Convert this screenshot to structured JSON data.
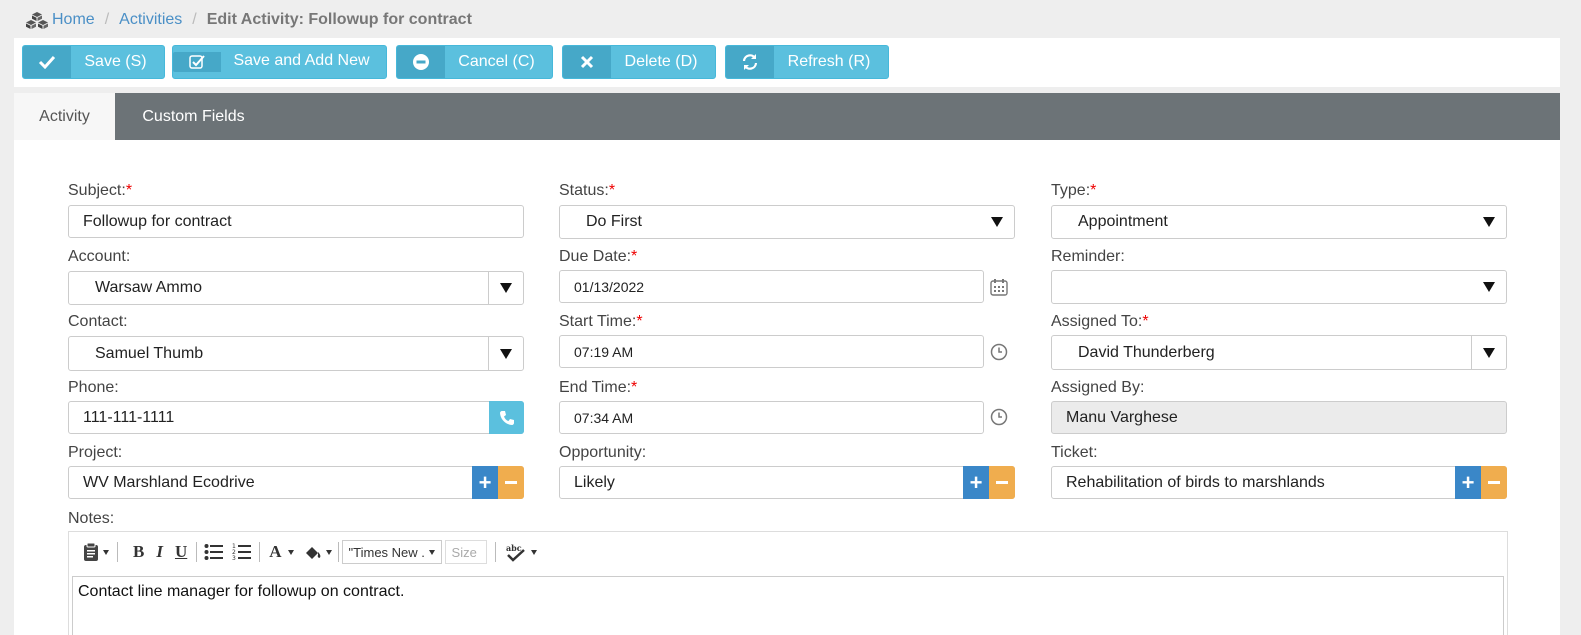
{
  "breadcrumb": {
    "home": "Home",
    "activities": "Activities",
    "current": "Edit Activity: Followup for contract"
  },
  "toolbar": {
    "save": "Save (S)",
    "save_add_new": "Save and Add New",
    "cancel": "Cancel (C)",
    "delete": "Delete (D)",
    "refresh": "Refresh (R)"
  },
  "tabs": {
    "activity": "Activity",
    "custom_fields": "Custom Fields"
  },
  "form": {
    "subject": {
      "label": "Subject:",
      "required": "*",
      "value": "Followup for contract"
    },
    "status": {
      "label": "Status:",
      "required": "*",
      "value": "Do First"
    },
    "type": {
      "label": "Type:",
      "required": "*",
      "value": "Appointment"
    },
    "account": {
      "label": "Account:",
      "value": "Warsaw Ammo"
    },
    "due_date": {
      "label": "Due Date:",
      "required": "*",
      "value": "01/13/2022"
    },
    "reminder": {
      "label": "Reminder:",
      "value": ""
    },
    "contact": {
      "label": "Contact:",
      "value": "Samuel Thumb"
    },
    "start_time": {
      "label": "Start Time:",
      "required": "*",
      "value": "07:19 AM"
    },
    "assigned_to": {
      "label": "Assigned To:",
      "required": "*",
      "value": "David Thunderberg"
    },
    "phone": {
      "label": "Phone:",
      "value": "111-111-1111"
    },
    "end_time": {
      "label": "End Time:",
      "required": "*",
      "value": "07:34 AM"
    },
    "assigned_by": {
      "label": "Assigned By:",
      "value": "Manu Varghese"
    },
    "project": {
      "label": "Project:",
      "value": "WV Marshland Ecodrive"
    },
    "opportunity": {
      "label": "Opportunity:",
      "value": "Likely"
    },
    "ticket": {
      "label": "Ticket:",
      "value": "Rehabilitation of birds to marshlands"
    },
    "notes": {
      "label": "Notes:",
      "value": "Contact line manager for followup on contract."
    }
  },
  "editor": {
    "bold": "B",
    "italic": "I",
    "underline": "U",
    "font_color": "A",
    "font_name": "\"Times New ...",
    "font_size_placeholder": "Size"
  },
  "colors": {
    "info": "#5bc0de",
    "primary": "#3a87c8",
    "warning": "#f0ad4e",
    "tabbar": "#6c7377"
  }
}
